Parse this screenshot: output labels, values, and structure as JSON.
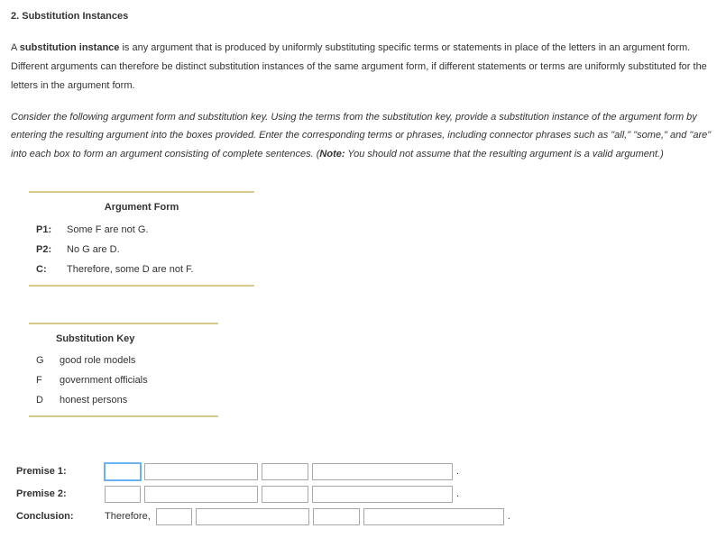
{
  "section_title": "2. Substitution Instances",
  "intro": {
    "pre": "A ",
    "bold": "substitution instance",
    "post": " is any argument that is produced by uniformly substituting specific terms or statements in place of the letters in an argument form. Different arguments can therefore be distinct substitution instances of the same argument form, if different statements or terms are uniformly substituted for the letters in the argument form."
  },
  "instructions": {
    "text": "Consider the following argument form and substitution key. Using the terms from the substitution key, provide a substitution instance of the argument form by entering the resulting argument into the boxes provided. Enter the corresponding terms or phrases, including connector phrases such as \"all,\" \"some,\" and \"are\" into each box to form an argument consisting of complete sentences. (",
    "note_label": "Note:",
    "note_text": " You should not assume that the resulting argument is a valid argument.)"
  },
  "argform": {
    "title": "Argument Form",
    "rows": [
      {
        "label": "P1:",
        "text": "Some F are not G."
      },
      {
        "label": "P2:",
        "text": "No G are D."
      },
      {
        "label": "C:",
        "text": "Therefore, some D are not F."
      }
    ]
  },
  "subkey": {
    "title": "Substitution Key",
    "rows": [
      {
        "label": "G",
        "text": "good role models"
      },
      {
        "label": "F",
        "text": "government officials"
      },
      {
        "label": "D",
        "text": "honest persons"
      }
    ]
  },
  "answers": {
    "premise1_label": "Premise 1:",
    "premise2_label": "Premise 2:",
    "conclusion_label": "Conclusion:",
    "therefore": "Therefore,",
    "period": "."
  }
}
